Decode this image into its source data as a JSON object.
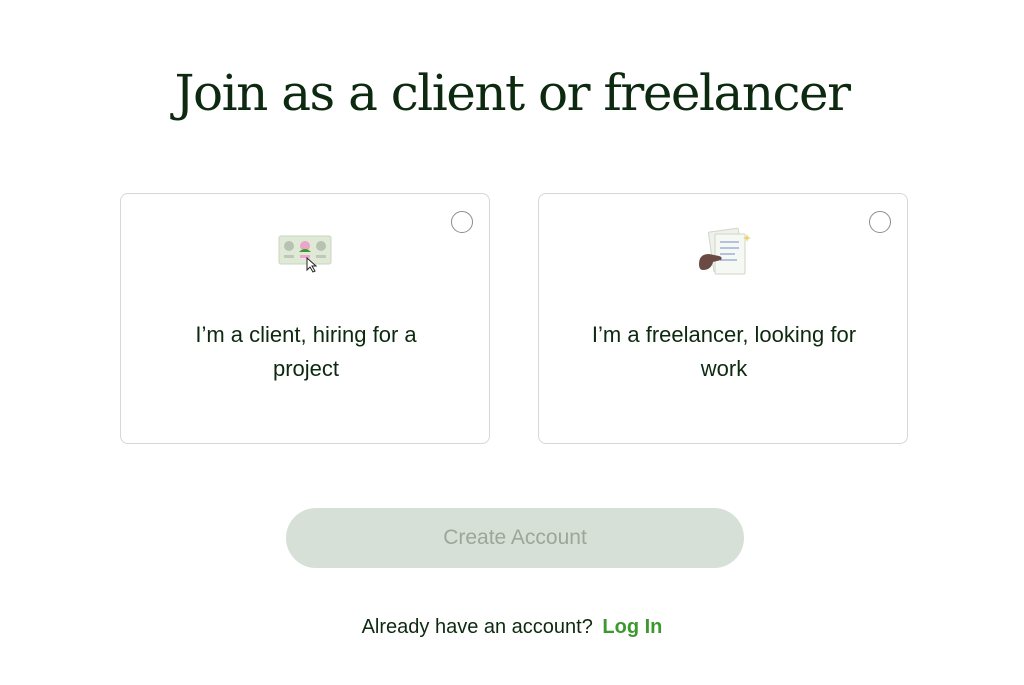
{
  "page": {
    "title": "Join as a client or freelancer"
  },
  "options": [
    {
      "id": "client",
      "label": "I’m a client, hiring for a project",
      "icon": "client-hiring-icon",
      "selected": false
    },
    {
      "id": "freelancer",
      "label": "I’m a freelancer, looking for work",
      "icon": "freelancer-document-icon",
      "selected": false
    }
  ],
  "actions": {
    "create_account_label": "Create Account",
    "create_account_enabled": false
  },
  "login": {
    "prompt": "Already have an account?",
    "link_label": "Log In"
  },
  "colors": {
    "title": "#0d2a10",
    "accent_link": "#3c9a2d",
    "button_disabled_bg": "#d7e0d6",
    "button_disabled_text": "#9aa899",
    "card_border": "#d5d8d5"
  }
}
